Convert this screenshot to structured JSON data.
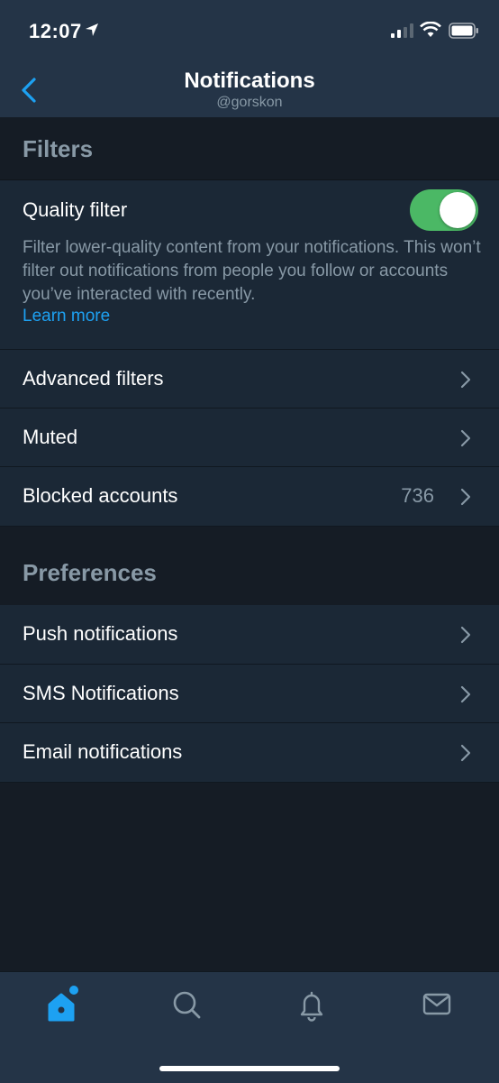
{
  "status_bar": {
    "time": "12:07"
  },
  "header": {
    "title": "Notifications",
    "subtitle": "@gorskon"
  },
  "filters": {
    "title": "Filters",
    "quality_filter": {
      "label": "Quality filter",
      "enabled": true,
      "description": "Filter lower-quality content from your notifications. This won’t filter out notifications from people you follow or accounts you’ve interacted with recently.",
      "learn_more": "Learn more"
    },
    "items": [
      {
        "label": "Advanced filters",
        "count": ""
      },
      {
        "label": "Muted",
        "count": ""
      },
      {
        "label": "Blocked accounts",
        "count": "736"
      }
    ]
  },
  "preferences": {
    "title": "Preferences",
    "items": [
      {
        "label": "Push notifications"
      },
      {
        "label": "SMS Notifications"
      },
      {
        "label": "Email notifications"
      }
    ]
  },
  "tab_bar": {
    "tabs": [
      {
        "name": "home",
        "icon": "home-icon",
        "active": true
      },
      {
        "name": "search",
        "icon": "search-icon",
        "active": false
      },
      {
        "name": "notifications",
        "icon": "bell-icon",
        "active": false
      },
      {
        "name": "messages",
        "icon": "mail-icon",
        "active": false
      }
    ]
  },
  "colors": {
    "background": "#151c25",
    "surface": "#1b2836",
    "nav": "#243447",
    "accent": "#1da1f2",
    "muted_text": "#8899a6",
    "toggle_on": "#4bb865"
  }
}
